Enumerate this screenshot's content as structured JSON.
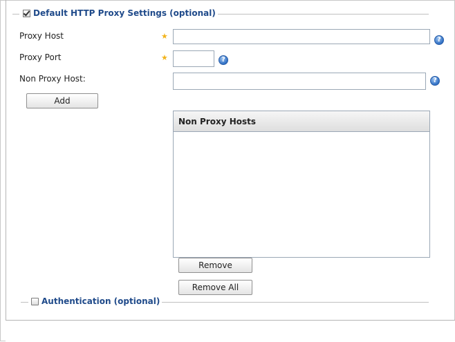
{
  "proxy_section": {
    "legend": "Default HTTP Proxy Settings (optional)",
    "checked": true
  },
  "fields": {
    "proxy_host": {
      "label": "Proxy Host",
      "value": "",
      "required": true
    },
    "proxy_port": {
      "label": "Proxy Port",
      "value": "",
      "required": true
    },
    "non_proxy_host": {
      "label": "Non Proxy Host:",
      "value": ""
    }
  },
  "buttons": {
    "add": "Add",
    "remove": "Remove",
    "remove_all": "Remove All"
  },
  "non_proxy_list": {
    "header": "Non Proxy Hosts",
    "items": []
  },
  "auth_section": {
    "legend": "Authentication (optional)",
    "checked": false
  },
  "icons": {
    "required": "star-icon",
    "help": "help-icon"
  },
  "colors": {
    "legend_text": "#1f4a8a",
    "required_star": "#f2b31b",
    "help_icon": "#2f6fc4"
  }
}
